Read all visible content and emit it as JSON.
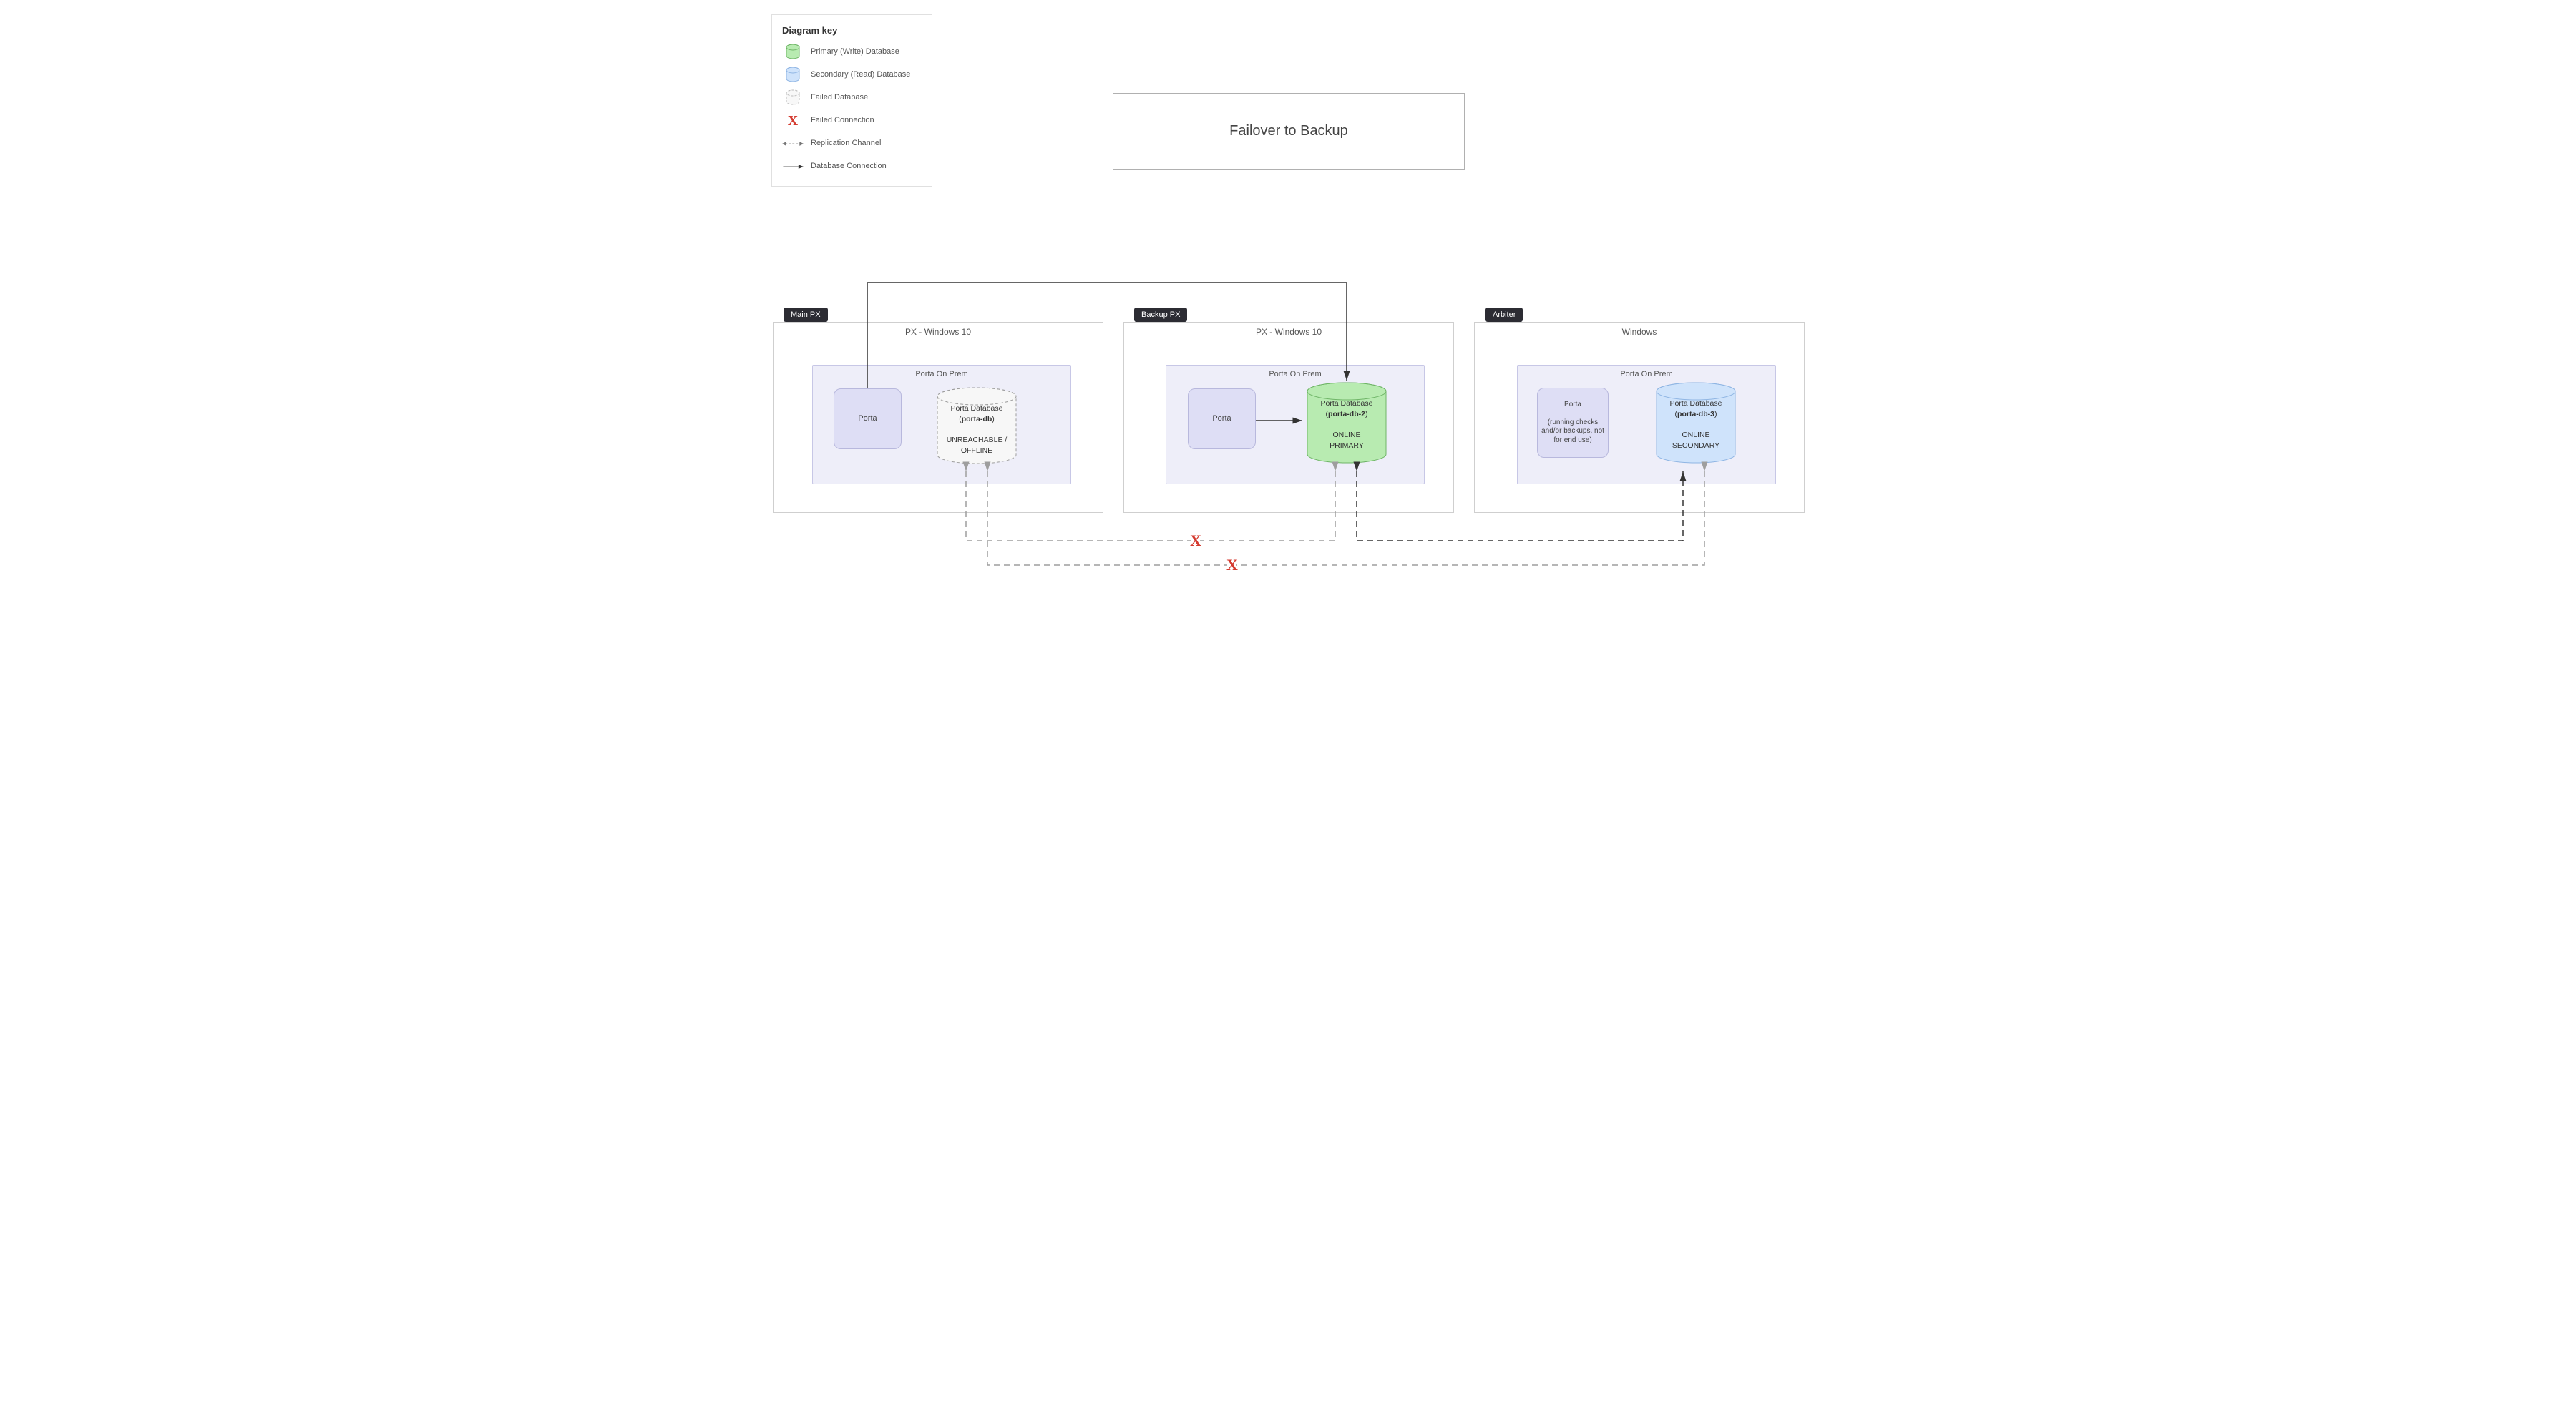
{
  "title": "Failover to Backup",
  "legend": {
    "heading": "Diagram key",
    "items": {
      "primary": "Primary (Write) Database",
      "secondary": "Secondary (Read) Database",
      "failed_db": "Failed Database",
      "failed_conn": "Failed Connection",
      "replication": "Replication Channel",
      "db_conn": "Database Connection"
    }
  },
  "groups": {
    "main": {
      "tag": "Main PX",
      "outer": "PX - Windows 10",
      "inner": "Porta On Prem"
    },
    "backup": {
      "tag": "Backup PX",
      "outer": "PX - Windows 10",
      "inner": "Porta On Prem"
    },
    "arbiter": {
      "tag": "Arbiter",
      "outer": "Windows",
      "inner": "Porta On Prem"
    }
  },
  "nodes": {
    "main_porta": "Porta",
    "backup_porta": "Porta",
    "arbiter_porta_l1": "Porta",
    "arbiter_porta_l2": "(running checks and/or backups, not for end use)"
  },
  "databases": {
    "main": {
      "title": "Porta Database",
      "id": "porta-db",
      "status1": "UNREACHABLE /",
      "status2": "OFFLINE"
    },
    "backup": {
      "title": "Porta Database",
      "id": "porta-db-2",
      "status1": "ONLINE",
      "status2": "PRIMARY"
    },
    "arbiter": {
      "title": "Porta Database",
      "id": "porta-db-3",
      "status1": "ONLINE",
      "status2": "SECONDARY"
    }
  },
  "colors": {
    "primary_fill": "#b8ebb1",
    "primary_stroke": "#6fb567",
    "secondary_fill": "#cfe3fb",
    "secondary_stroke": "#8fb5e3",
    "failed_fill": "#f8f8f8",
    "failed_stroke": "#bdbdbd",
    "red": "#d43a2f"
  }
}
